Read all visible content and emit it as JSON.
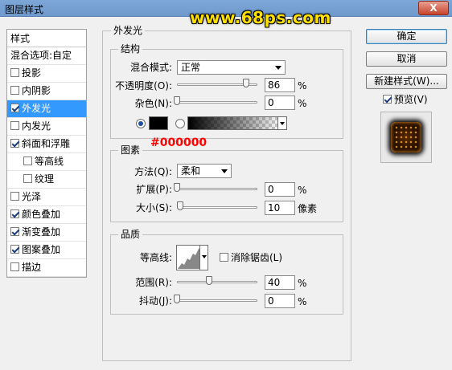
{
  "window": {
    "title": "图层样式",
    "close_label": "X"
  },
  "watermark": "www.68ps.com",
  "styles_panel": {
    "header": "样式",
    "items": [
      {
        "label": "混合选项:自定",
        "has_checkbox": false,
        "checked": false,
        "selected": false,
        "sub": false
      },
      {
        "label": "投影",
        "has_checkbox": true,
        "checked": false,
        "selected": false,
        "sub": false
      },
      {
        "label": "内阴影",
        "has_checkbox": true,
        "checked": false,
        "selected": false,
        "sub": false
      },
      {
        "label": "外发光",
        "has_checkbox": true,
        "checked": true,
        "selected": true,
        "sub": false
      },
      {
        "label": "内发光",
        "has_checkbox": true,
        "checked": false,
        "selected": false,
        "sub": false
      },
      {
        "label": "斜面和浮雕",
        "has_checkbox": true,
        "checked": true,
        "selected": false,
        "sub": false
      },
      {
        "label": "等高线",
        "has_checkbox": true,
        "checked": false,
        "selected": false,
        "sub": true
      },
      {
        "label": "纹理",
        "has_checkbox": true,
        "checked": false,
        "selected": false,
        "sub": true
      },
      {
        "label": "光泽",
        "has_checkbox": true,
        "checked": false,
        "selected": false,
        "sub": false
      },
      {
        "label": "颜色叠加",
        "has_checkbox": true,
        "checked": true,
        "selected": false,
        "sub": false
      },
      {
        "label": "渐变叠加",
        "has_checkbox": true,
        "checked": true,
        "selected": false,
        "sub": false
      },
      {
        "label": "图案叠加",
        "has_checkbox": true,
        "checked": true,
        "selected": false,
        "sub": false
      },
      {
        "label": "描边",
        "has_checkbox": true,
        "checked": false,
        "selected": false,
        "sub": false
      }
    ]
  },
  "outer_glow": {
    "title": "外发光",
    "structure": {
      "title": "结构",
      "blend_mode_label": "混合模式:",
      "blend_mode_value": "正常",
      "opacity_label": "不透明度(O):",
      "opacity_value": "86",
      "opacity_unit": "%",
      "noise_label": "杂色(N):",
      "noise_value": "0",
      "noise_unit": "%",
      "color_mode": "solid",
      "glow_color": "#000000"
    },
    "annotation": "#000000",
    "elements": {
      "title": "图素",
      "method_label": "方法(Q):",
      "method_value": "柔和",
      "spread_label": "扩展(P):",
      "spread_value": "0",
      "spread_unit": "%",
      "size_label": "大小(S):",
      "size_value": "10",
      "size_unit": "像素"
    },
    "quality": {
      "title": "品质",
      "contour_label": "等高线:",
      "antialias_label": "消除锯齿(L)",
      "antialias_checked": false,
      "range_label": "范围(R):",
      "range_value": "40",
      "range_unit": "%",
      "jitter_label": "抖动(J):",
      "jitter_value": "0",
      "jitter_unit": "%"
    }
  },
  "buttons": {
    "ok": "确定",
    "cancel": "取消",
    "new_style": "新建样式(W)...",
    "preview_label": "预览(V)",
    "preview_checked": true
  },
  "colors": {
    "selection": "#3399ff",
    "annotation": "#ff0000",
    "watermark": "#ffe000"
  }
}
